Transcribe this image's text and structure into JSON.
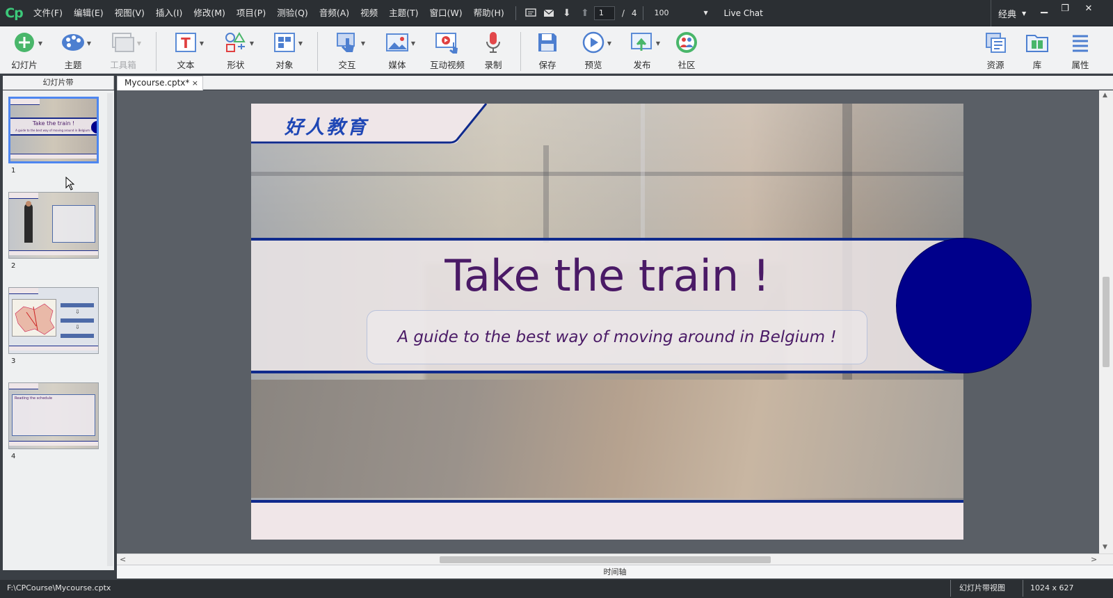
{
  "app": {
    "logo": "Cp"
  },
  "menu": [
    "文件(F)",
    "编辑(E)",
    "视图(V)",
    "插入(I)",
    "修改(M)",
    "项目(P)",
    "测验(Q)",
    "音频(A)",
    "视频",
    "主题(T)",
    "窗口(W)",
    "帮助(H)"
  ],
  "nav": {
    "current_page": "1",
    "total_pages": "4",
    "zoom": "100",
    "live_chat": "Live Chat"
  },
  "workspace": "经典",
  "toolbar": {
    "slide": "幻灯片",
    "theme": "主题",
    "toolbox": "工具箱",
    "text": "文本",
    "shape": "形状",
    "object": "对象",
    "interaction": "交互",
    "media": "媒体",
    "interactive_video": "互动视频",
    "record": "录制",
    "save": "保存",
    "preview": "预览",
    "publish": "发布",
    "community": "社区",
    "assets": "资源",
    "library": "库",
    "properties": "属性"
  },
  "filmstrip": {
    "header": "幻灯片带",
    "slides": [
      {
        "num": "1",
        "title": "Take the train !",
        "subtitle": "A guide to the best way of moving around in Belgium !"
      },
      {
        "num": "2"
      },
      {
        "num": "3"
      },
      {
        "num": "4",
        "title": "Reading the schedule"
      }
    ]
  },
  "document_tab": "Mycourse.cptx*",
  "slide": {
    "logo_text": "好人教育",
    "title": "Take the train !",
    "subtitle": "A guide to the best way of moving around in Belgium !"
  },
  "timeline": "时间轴",
  "status": {
    "path": "F:\\CPCourse\\Mycourse.cptx",
    "view": "幻灯片带视图",
    "size": "1024 x 627"
  },
  "colors": {
    "title_purple": "#4a1a66",
    "band_navy": "#0f2a8c",
    "circle_blue": "#00008b",
    "logo_blue": "#1f47b5",
    "selection": "#4d86f0"
  }
}
